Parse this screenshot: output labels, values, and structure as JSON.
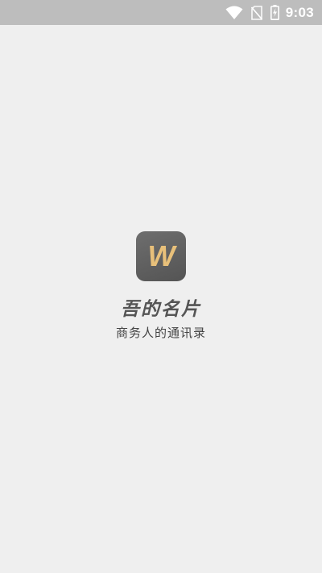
{
  "status_bar": {
    "time": "9:03",
    "icons": [
      "wifi-icon",
      "no-sim-icon",
      "battery-charging-icon"
    ]
  },
  "splash": {
    "logo_letter": "W",
    "app_name": "吾的名片",
    "tagline": "商务人的通讯录"
  },
  "colors": {
    "background": "#efefef",
    "status_bar": "#bdbdbd",
    "logo_bg": "#5e5e5e",
    "logo_letter": "#e8c07a",
    "title": "#555555"
  }
}
